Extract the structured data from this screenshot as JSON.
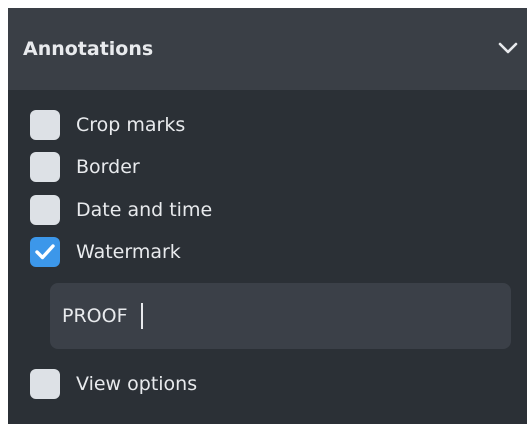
{
  "panel": {
    "title": "Annotations",
    "collapse_icon": "chevron-down-icon"
  },
  "options": {
    "crop_marks": {
      "label": "Crop marks",
      "checked": false
    },
    "border": {
      "label": "Border",
      "checked": false
    },
    "date_time": {
      "label": "Date and time",
      "checked": false
    },
    "watermark": {
      "label": "Watermark",
      "checked": true
    },
    "view_options": {
      "label": "View options",
      "checked": false
    }
  },
  "watermark_text": {
    "value": "PROOF"
  },
  "colors": {
    "panel_bg": "#2b3036",
    "header_bg": "#3a3f46",
    "checkbox_unchecked": "#dde1e6",
    "checkbox_checked": "#3c97ea",
    "input_bg": "#3b4048",
    "text": "#e8eaed"
  }
}
